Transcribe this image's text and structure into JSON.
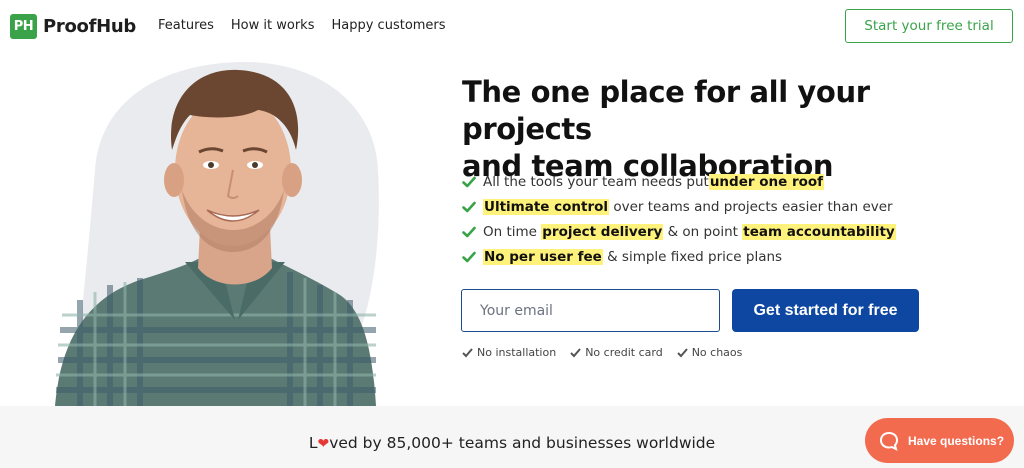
{
  "header": {
    "logo_badge": "PH",
    "logo_text": "ProofHub",
    "nav": [
      "Features",
      "How it works",
      "Happy customers"
    ],
    "trial_label": "Start your free trial"
  },
  "hero": {
    "headline_line1": "The one place for all your projects",
    "headline_line2": "and team collaboration",
    "features": [
      {
        "pre": "All the tools your team needs put ",
        "hl1": "under one roof",
        "mid": "",
        "hl2": "",
        "post": ""
      },
      {
        "pre": "",
        "hl1": "Ultimate control",
        "mid": " over teams and projects easier than ever",
        "hl2": "",
        "post": ""
      },
      {
        "pre": "On time ",
        "hl1": "project delivery",
        "mid": " & on point ",
        "hl2": "team accountability",
        "post": ""
      },
      {
        "pre": "",
        "hl1": "No per user fee",
        "mid": " & simple fixed price plans",
        "hl2": "",
        "post": ""
      }
    ],
    "email_placeholder": "Your email",
    "cta_label": "Get started for free",
    "badges": [
      "No installation",
      "No credit card",
      "No chaos"
    ]
  },
  "strip": {
    "loved_pre": "L",
    "loved_post": "ved by 85,000+ teams and businesses worldwide"
  },
  "help": {
    "label": "Have questions?"
  },
  "colors": {
    "brand_green": "#3aa34a",
    "cta_blue": "#0d47a1",
    "highlight": "#fff27a",
    "help_orange": "#f26b4f"
  },
  "icons": [
    "check-icon",
    "chat-bubble-icon",
    "heart-icon",
    "person-photo"
  ]
}
